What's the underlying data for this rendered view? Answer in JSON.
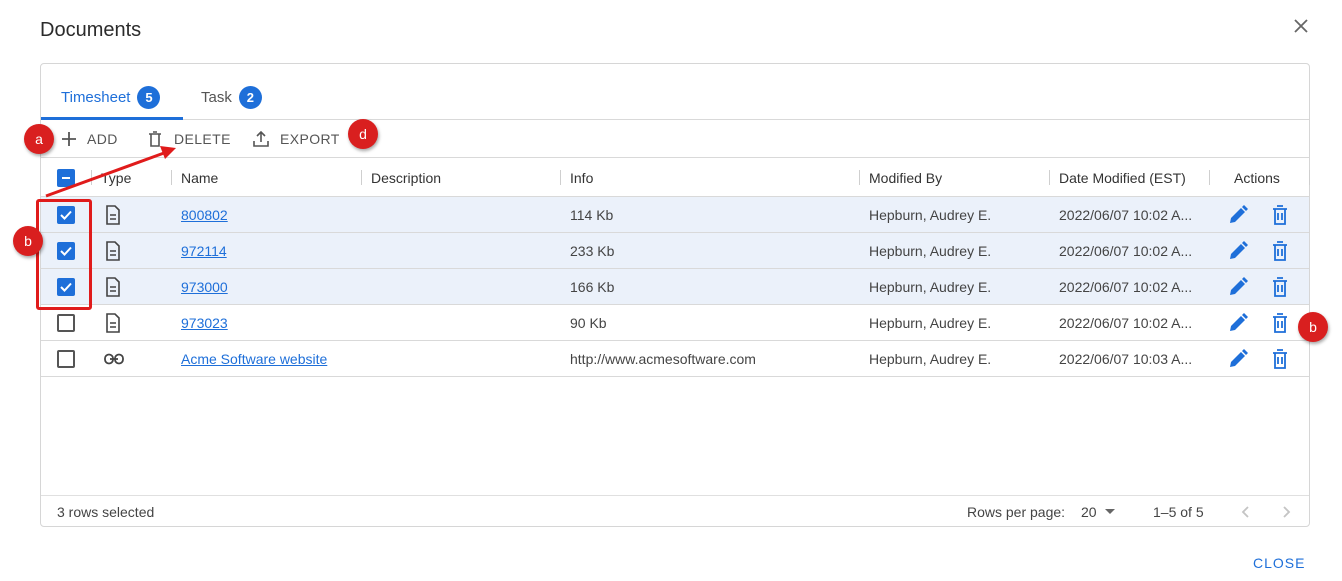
{
  "dialog": {
    "title": "Documents",
    "close_label": "CLOSE"
  },
  "tabs": [
    {
      "label": "Timesheet",
      "count": "5"
    },
    {
      "label": "Task",
      "count": "2"
    }
  ],
  "toolbar": {
    "add_label": "ADD",
    "delete_label": "DELETE",
    "export_label": "EXPORT"
  },
  "columns": {
    "type": "Type",
    "name": "Name",
    "description": "Description",
    "info": "Info",
    "modified_by": "Modified By",
    "date_modified": "Date Modified (EST)",
    "actions": "Actions"
  },
  "rows": [
    {
      "selected": true,
      "type_icon": "document-icon",
      "name": "800802",
      "description": "",
      "info": "114 Kb",
      "modified_by": "Hepburn, Audrey E.",
      "date_modified": "2022/06/07 10:02 A..."
    },
    {
      "selected": true,
      "type_icon": "document-icon",
      "name": "972114",
      "description": "",
      "info": "233 Kb",
      "modified_by": "Hepburn, Audrey E.",
      "date_modified": "2022/06/07 10:02 A..."
    },
    {
      "selected": true,
      "type_icon": "document-icon",
      "name": "973000",
      "description": "",
      "info": "166 Kb",
      "modified_by": "Hepburn, Audrey E.",
      "date_modified": "2022/06/07 10:02 A..."
    },
    {
      "selected": false,
      "type_icon": "document-icon",
      "name": "973023",
      "description": "",
      "info": "90 Kb",
      "modified_by": "Hepburn, Audrey E.",
      "date_modified": "2022/06/07 10:02 A..."
    },
    {
      "selected": false,
      "type_icon": "link-icon",
      "name": "Acme Software website",
      "description": "",
      "info": "http://www.acmesoftware.com",
      "modified_by": "Hepburn, Audrey E.",
      "date_modified": "2022/06/07 10:03 A..."
    }
  ],
  "footer": {
    "selection_status": "3 rows selected",
    "rows_per_page_label": "Rows per page:",
    "rows_per_page_value": "20",
    "page_range": "1–5 of 5"
  },
  "annotations": {
    "a": "a",
    "b": "b",
    "d": "d"
  },
  "colors": {
    "accent": "#1e6fd9",
    "callout": "#d91f1f",
    "selected_row": "#ebf1fa"
  }
}
